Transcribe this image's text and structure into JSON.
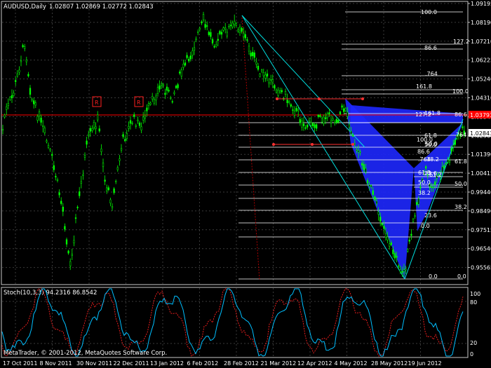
{
  "header": {
    "symbol_title": "AUDUSD,Daily",
    "ohlc": "1.02807 1.02869 1.02772 1.02843"
  },
  "indicator": {
    "title": "Stoch(10,3,3) 94.2316 86.8542",
    "levels": [
      "100",
      "80",
      "20",
      "0"
    ]
  },
  "copyright": "MetaTrader, © 2001-2012, MetaQuotes Software Corp.",
  "price_axis": {
    "labels": [
      "1.09195",
      "1.08190",
      "1.07210",
      "1.06225",
      "1.05240",
      "1.04310",
      "1.03340",
      "1.02365",
      "1.01390",
      "1.00415",
      "0.99440",
      "0.98490",
      "0.97515",
      "0.96540",
      "0.95565"
    ],
    "current_price": "1.02843",
    "red_line_price": "1.03793"
  },
  "time_axis": {
    "labels": [
      "17 Oct 2011",
      "8 Nov 2011",
      "30 Nov 2011",
      "22 Dec 2011",
      "13 Jan 2012",
      "6 Feb 2012",
      "28 Feb 2012",
      "21 Mar 2012",
      "12 Apr 2012",
      "4 May 2012",
      "28 May 2012",
      "19 Jun 2012"
    ]
  },
  "fib_labels": {
    "main": [
      "100.0",
      "127.2",
      "86.6",
      ".764",
      "161.8",
      "100.0",
      "61.8",
      "50.0",
      "38.2",
      "23.6",
      "0.0",
      "0.0"
    ],
    "secondary": [
      "161.8",
      "127.2",
      "86.6",
      "100.0",
      "50.0",
      "86.6",
      ".764",
      "61.8",
      "50.0",
      "61.2",
      "38.2",
      "38.2",
      "23.6",
      "0.0",
      "764",
      "61.8",
      "50.0"
    ]
  },
  "markers": [
    "R",
    "R"
  ],
  "colors": {
    "background": "#000000",
    "grid": "#3a3a3a",
    "candles": "#00ff00",
    "red_line": "#ff0000",
    "pattern_fill": "#0000ff",
    "fib_lines": "#ffffff",
    "trend_lines": "#00ffff",
    "stoch_main": "#00bfff",
    "stoch_signal": "#ff0000"
  }
}
